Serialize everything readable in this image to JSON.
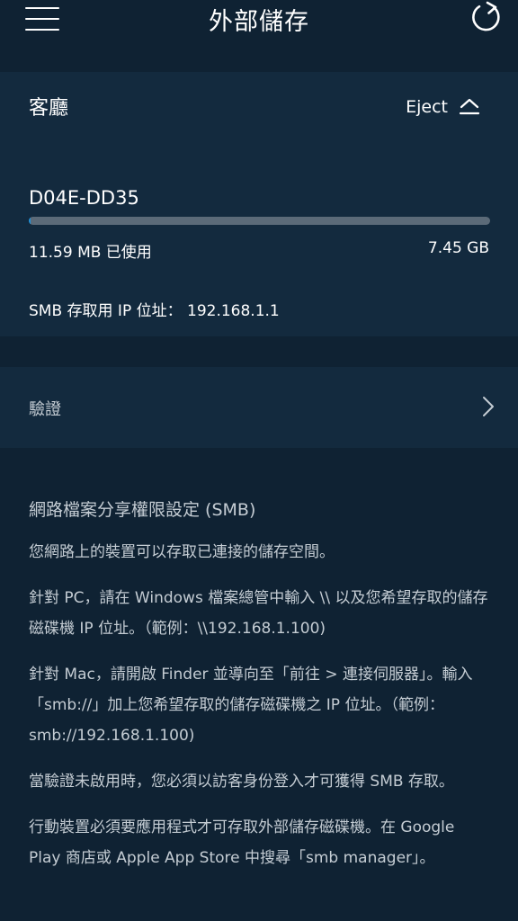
{
  "header": {
    "title": "外部儲存"
  },
  "drive": {
    "name": "客廳",
    "eject_label": "Eject",
    "device_id": "D04E-DD35",
    "used": "11.59 MB 已使用",
    "total": "7.45 GB",
    "usage_fraction": 0.0015,
    "smb_ip": "SMB 存取用 IP 位址： 192.168.1.1"
  },
  "auth": {
    "label": "驗證"
  },
  "info": {
    "title": "網路檔案分享權限設定 (SMB)",
    "paragraphs": [
      "您網路上的裝置可以存取已連接的儲存空間。",
      "針對 PC，請在 Windows 檔案總管中輸入 \\\\ 以及您希望存取的儲存磁碟機 IP 位址。（範例：\\\\192.168.1.100)",
      "針對 Mac，請開啟 Finder 並導向至「前往 > 連接伺服器」。輸入「smb://」加上您希望存取的儲存磁碟機之 IP 位址。（範例：smb://192.168.1.100)",
      "當驗證未啟用時，您必須以訪客身份登入才可獲得 SMB 存取。",
      "行動裝置必須要應用程式才可存取外部儲存磁碟機。在 Google Play 商店或 Apple App Store 中搜尋「smb manager」。"
    ]
  },
  "colors": {
    "background": "#0f2233",
    "card": "#132a3e",
    "progress_track": "#5b6a78",
    "progress_fill": "#1f8fd6",
    "secondary_text": "#c4ccd3"
  },
  "icons": {
    "menu": "hamburger-menu-icon",
    "refresh": "refresh-icon",
    "eject": "eject-icon",
    "chevron": "chevron-right-icon"
  }
}
